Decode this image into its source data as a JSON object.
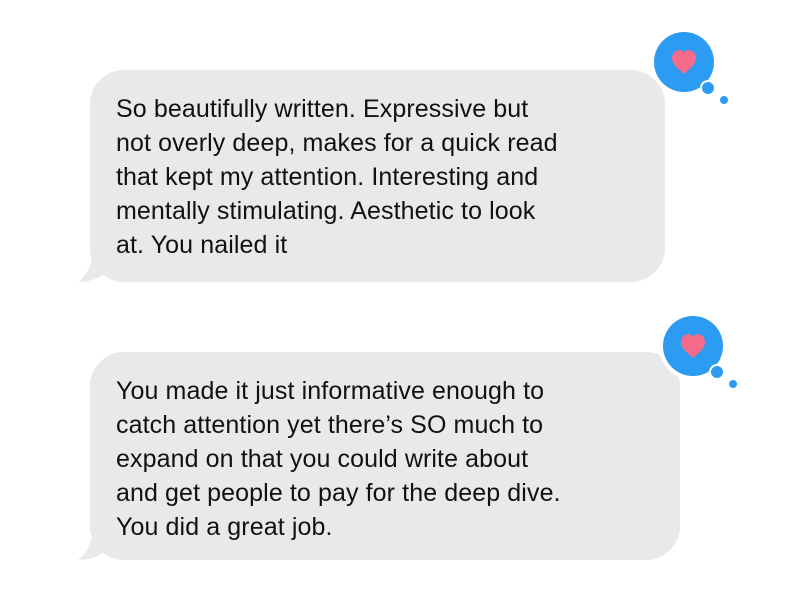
{
  "conversation": {
    "messages": [
      {
        "text": "So beautifully written. Expressive but\nnot overly deep, makes for a quick read\nthat kept my attention. Interesting and\nmentally stimulating. Aesthetic to look\nat. You nailed it",
        "reaction": "heart-icon"
      },
      {
        "text": "You made it just informative enough to\ncatch attention yet there’s SO much to\nexpand on that you could write about\nand get people to pay for the deep dive.\nYou did a great job.",
        "reaction": "heart-icon"
      }
    ]
  },
  "colors": {
    "bubble": "#e9e9eb",
    "reaction_blue": "#2b9cf2",
    "heart_pink": "#f76b8a",
    "text": "#111111"
  }
}
